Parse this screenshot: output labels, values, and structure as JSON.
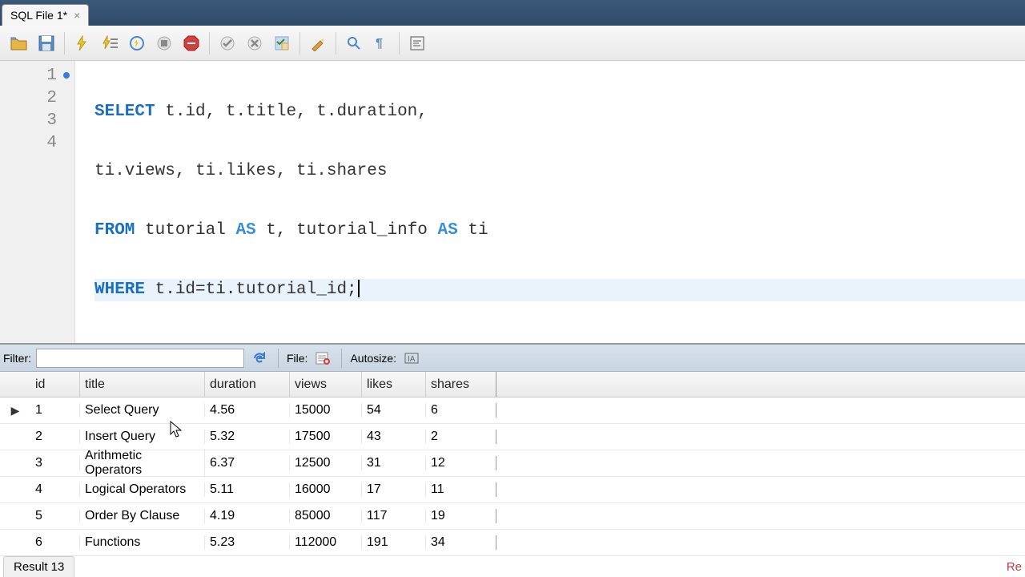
{
  "tab": {
    "label": "SQL File 1*"
  },
  "editor": {
    "lines": [
      "1",
      "2",
      "3",
      "4"
    ],
    "code": {
      "line1_select": "SELECT",
      "line1_rest": " t.id, t.title, t.duration,",
      "line2": "ti.views, ti.likes, ti.shares",
      "line3_from": "FROM",
      "line3_mid": " tutorial ",
      "line3_as1": "AS",
      "line3_t": " t, tutorial_info ",
      "line3_as2": "AS",
      "line3_ti": " ti",
      "line4_where": "WHERE",
      "line4_rest": " t.id=ti.tutorial_id;"
    }
  },
  "filter": {
    "label": "Filter:",
    "file_label": "File:",
    "autosize_label": "Autosize:"
  },
  "columns": {
    "id": "id",
    "title": "title",
    "duration": "duration",
    "views": "views",
    "likes": "likes",
    "shares": "shares"
  },
  "chart_data": {
    "type": "table",
    "columns": [
      "id",
      "title",
      "duration",
      "views",
      "likes",
      "shares"
    ],
    "rows": [
      {
        "id": "1",
        "title": "Select Query",
        "duration": "4.56",
        "views": "15000",
        "likes": "54",
        "shares": "6"
      },
      {
        "id": "2",
        "title": "Insert Query",
        "duration": "5.32",
        "views": "17500",
        "likes": "43",
        "shares": "2"
      },
      {
        "id": "3",
        "title": "Arithmetic Operators",
        "duration": "6.37",
        "views": "12500",
        "likes": "31",
        "shares": "12"
      },
      {
        "id": "4",
        "title": "Logical Operators",
        "duration": "5.11",
        "views": "16000",
        "likes": "17",
        "shares": "11"
      },
      {
        "id": "5",
        "title": "Order By Clause",
        "duration": "4.19",
        "views": "85000",
        "likes": "117",
        "shares": "19"
      },
      {
        "id": "6",
        "title": "Functions",
        "duration": "5.23",
        "views": "112000",
        "likes": "191",
        "shares": "34"
      }
    ]
  },
  "status": {
    "tab_label": "Result 13",
    "right": "Re"
  }
}
